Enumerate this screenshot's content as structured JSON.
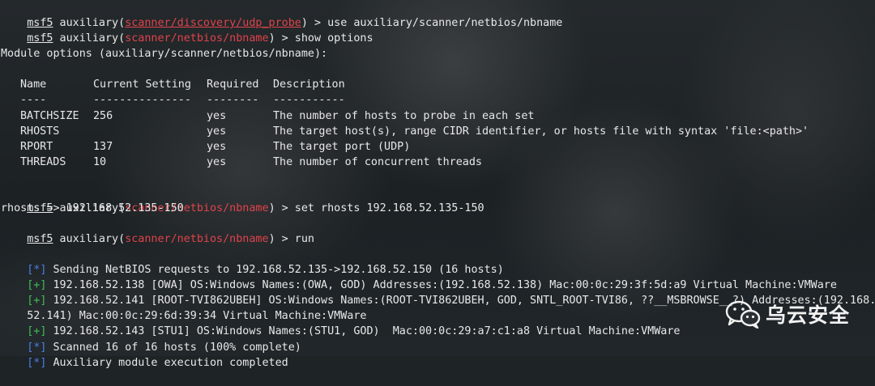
{
  "terminal": {
    "lines": [
      {
        "prompt": "msf5",
        "pre": " auxiliary(",
        "module": "scanner/discovery/udp_probe",
        "module_underline": true,
        "post": ") > use auxiliary/scanner/netbios/nbname"
      },
      {
        "prompt": "msf5",
        "pre": " auxiliary(",
        "module": "scanner/netbios/nbname",
        "post": ") > show options"
      }
    ],
    "module_options_title": "Module options (auxiliary/scanner/netbios/nbname):",
    "table": {
      "headers": [
        "Name",
        "Current Setting",
        "Required",
        "Description"
      ],
      "separators": [
        "----",
        "---------------",
        "--------",
        "-----------"
      ],
      "rows": [
        {
          "name": "BATCHSIZE",
          "setting": "256",
          "required": "yes",
          "description": "The number of hosts to probe in each set"
        },
        {
          "name": "RHOSTS",
          "setting": "",
          "required": "yes",
          "description": "The target host(s), range CIDR identifier, or hosts file with syntax 'file:<path>'"
        },
        {
          "name": "RPORT",
          "setting": "137",
          "required": "yes",
          "description": "The target port (UDP)"
        },
        {
          "name": "THREADS",
          "setting": "10",
          "required": "yes",
          "description": "The number of concurrent threads"
        }
      ]
    },
    "cmd_set": {
      "prompt": "msf5",
      "pre": " auxiliary(",
      "module": "scanner/netbios/nbname",
      "post": ") > set rhosts 192.168.52.135-150"
    },
    "set_result": "rhosts => 192.168.52.135-150",
    "cmd_run": {
      "prompt": "msf5",
      "pre": " auxiliary(",
      "module": "scanner/netbios/nbname",
      "post": ") > run"
    },
    "output": [
      {
        "tag": "[*]",
        "kind": "blue",
        "text": " Sending NetBIOS requests to 192.168.52.135->192.168.52.150 (16 hosts)"
      },
      {
        "tag": "[+]",
        "kind": "green",
        "text": " 192.168.52.138 [OWA] OS:Windows Names:(OWA, GOD) Addresses:(192.168.52.138) Mac:00:0c:29:3f:5d:a9 Virtual Machine:VMWare"
      },
      {
        "tag": "[+]",
        "kind": "green",
        "text": " 192.168.52.141 [ROOT-TVI862UBEH] OS:Windows Names:(ROOT-TVI862UBEH, GOD, SNTL_ROOT-TVI86, ??__MSBROWSE__?) Addresses:(192.168."
      },
      {
        "tag": "",
        "kind": "plain",
        "text": "52.141) Mac:00:0c:29:6d:39:34 Virtual Machine:VMWare"
      },
      {
        "tag": "[+]",
        "kind": "green",
        "text": " 192.168.52.143 [STU1] OS:Windows Names:(STU1, GOD)  Mac:00:0c:29:a7:c1:a8 Virtual Machine:VMWare"
      },
      {
        "tag": "[*]",
        "kind": "blue",
        "text": " Scanned 16 of 16 hosts (100% complete)"
      },
      {
        "tag": "[*]",
        "kind": "blue",
        "text": " Auxiliary module execution completed"
      }
    ]
  },
  "watermark": {
    "text": "乌云安全",
    "icon": "wechat-icon"
  },
  "colors": {
    "prompt_module": "#e0434a",
    "info": "#4d7ee8",
    "success": "#3fbf54",
    "text": "#e8e8e8"
  }
}
